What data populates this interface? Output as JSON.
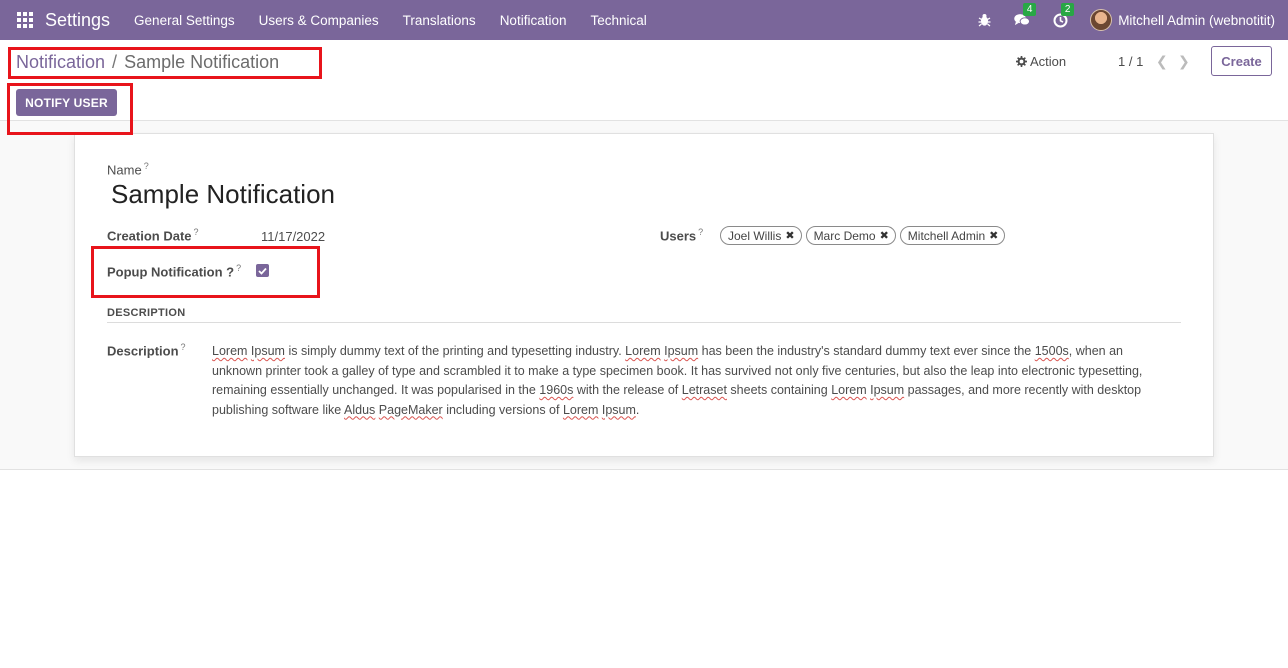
{
  "navbar": {
    "app_title": "Settings",
    "menu": [
      "General Settings",
      "Users & Companies",
      "Translations",
      "Notification",
      "Technical"
    ],
    "messages_count": "4",
    "activities_count": "2",
    "user": "Mitchell Admin (webnotitit)",
    "icons": [
      "apps-icon",
      "bug-icon",
      "chat-icon",
      "clock-icon",
      "avatar"
    ]
  },
  "breadcrumb": {
    "parent": "Notification",
    "separator": "/",
    "current": "Sample Notification"
  },
  "control": {
    "action_label": "Action",
    "pager": "1 / 1",
    "create_label": "Create",
    "notify_label": "NOTIFY USER"
  },
  "form": {
    "name_label": "Name",
    "name_value": "Sample Notification",
    "creation_date_label": "Creation Date",
    "creation_date_value": "11/17/2022",
    "users_label": "Users",
    "users": [
      "Joel Willis",
      "Marc Demo",
      "Mitchell Admin"
    ],
    "popup_label": "Popup Notification ?",
    "popup_checked": true,
    "help_mark": "?",
    "section_title": "DESCRIPTION",
    "description_label": "Description",
    "description": "Lorem Ipsum is simply dummy text of the printing and typesetting industry. Lorem Ipsum has been the industry's standard dummy text ever since the 1500s, when an unknown printer took a galley of type and scrambled it to make a type specimen book. It has survived not only five centuries, but also the leap into electronic typesetting, remaining essentially unchanged. It was popularised in the 1960s with the release of Letraset sheets containing Lorem Ipsum passages, and more recently with desktop publishing software like Aldus PageMaker including versions of Lorem Ipsum."
  },
  "colors": {
    "brand": "#7a669a",
    "badge": "#28a745",
    "annotation": "#e8141b"
  }
}
